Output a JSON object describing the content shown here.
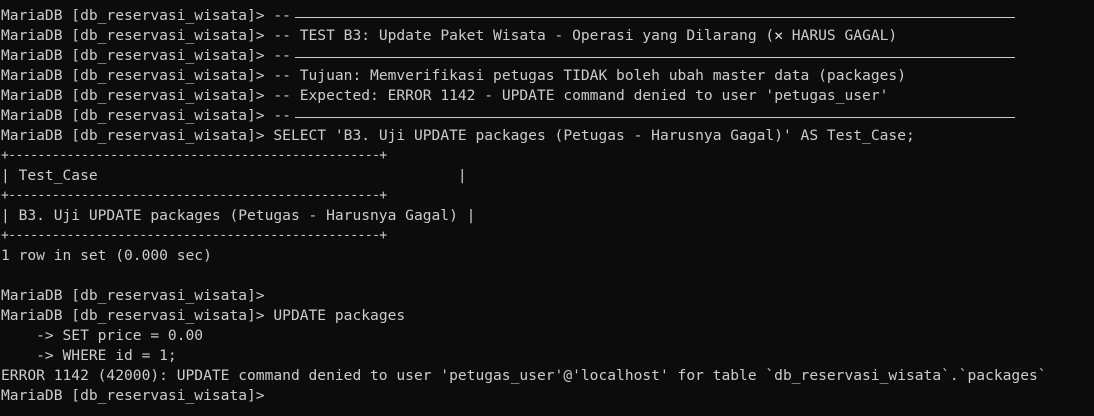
{
  "terminal": {
    "prompt": "MariaDB [db_reservasi_wisata]>",
    "lines": {
      "l1": {
        "prompt": "MariaDB [db_reservasi_wisata]>",
        "text": " --"
      },
      "l2": {
        "prompt": "MariaDB [db_reservasi_wisata]>",
        "text_a": " -- TEST B3: Update Paket Wisata - Operasi yang Dilarang (",
        "cross": "✕",
        "text_b": " HARUS GAGAL)"
      },
      "l3": {
        "prompt": "MariaDB [db_reservasi_wisata]>",
        "text": " --"
      },
      "l4": {
        "prompt": "MariaDB [db_reservasi_wisata]>",
        "text": " -- Tujuan: Memverifikasi petugas TIDAK boleh ubah master data (packages)"
      },
      "l5": {
        "prompt": "MariaDB [db_reservasi_wisata]>",
        "text": " -- Expected: ERROR 1142 - UPDATE command denied to user 'petugas_user'"
      },
      "l6": {
        "prompt": "MariaDB [db_reservasi_wisata]>",
        "text": " --"
      },
      "l7": {
        "prompt": "MariaDB [db_reservasi_wisata]>",
        "text": " SELECT 'B3. Uji UPDATE packages (Petugas - Harusnya Gagal)' AS Test_Case;"
      },
      "table_border": "+---------------------------------------------------+",
      "table_header": "| Test_Case                                         |",
      "table_row": "| B3. Uji UPDATE packages (Petugas - Harusnya Gagal) |",
      "row_count": "1 row in set (0.000 sec)",
      "l_blank": "",
      "l8": {
        "prompt": "MariaDB [db_reservasi_wisata]>",
        "text": ""
      },
      "l9": {
        "prompt": "MariaDB [db_reservasi_wisata]>",
        "text": " UPDATE packages"
      },
      "l10": "    -> SET price = 0.00",
      "l11": "    -> WHERE id = 1;",
      "error": "ERROR 1142 (42000): UPDATE command denied to user 'petugas_user'@'localhost' for table `db_reservasi_wisata`.`packages`",
      "l12": {
        "prompt": "MariaDB [db_reservasi_wisata]>",
        "text": ""
      }
    }
  },
  "colors": {
    "background": "#0c0c0c",
    "foreground": "#cccccc"
  }
}
